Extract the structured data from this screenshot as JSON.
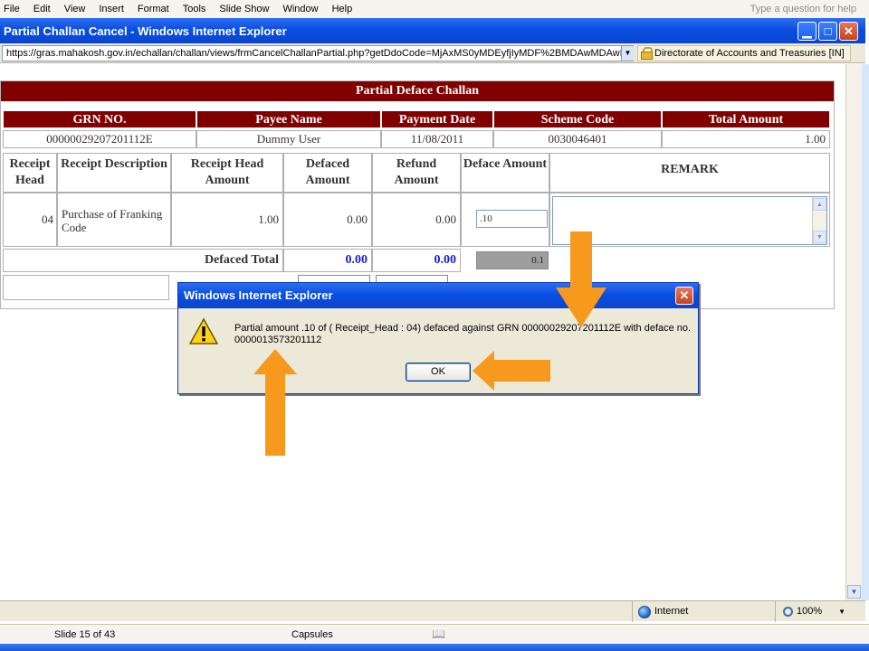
{
  "ppt_menu": [
    "File",
    "Edit",
    "View",
    "Insert",
    "Format",
    "Tools",
    "Slide Show",
    "Window",
    "Help"
  ],
  "ppt_help_placeholder": "Type a question for help",
  "ie_title": "Partial Challan Cancel - Windows Internet Explorer",
  "address_url": "https://gras.mahakosh.gov.in/echallan/challan/views/frmCancelChallanPartial.php?getDdoCode=MjAxMS0yMDEyfjIyMDF%2BMDAwMDAwMj",
  "cert_label": "Directorate of Accounts and Treasuries [IN]",
  "form": {
    "title": "Partial Deface Challan",
    "summary_headers": [
      "GRN NO.",
      "Payee Name",
      "Payment Date",
      "Scheme Code",
      "Total Amount"
    ],
    "summary_values": [
      "00000029207201112E",
      "Dummy User",
      "11/08/2011",
      "0030046401",
      "1.00"
    ],
    "detail_headers": {
      "receipt_head": "Receipt Head",
      "receipt_desc": "Receipt Description",
      "head_amount": "Receipt Head Amount",
      "defaced_amount": "Defaced Amount",
      "refund_amount": "Refund Amount",
      "deface_amount": "Deface Amount",
      "remark": "REMARK"
    },
    "row": {
      "receipt_head": "04",
      "receipt_desc": "Purchase of Franking Code",
      "head_amount": "1.00",
      "defaced_amount": "0.00",
      "refund_amount": "0.00",
      "deface_input": ".10"
    },
    "totals": {
      "label": "Defaced Total",
      "defaced": "0.00",
      "refund": "0.00",
      "deface": "0.1"
    }
  },
  "dialog": {
    "title": "Windows Internet Explorer",
    "message": "Partial amount .10 of ( Receipt_Head : 04)  defaced against GRN 00000029207201112E with deface no. 0000013573201112",
    "ok_label": "OK"
  },
  "ie_status": {
    "zone": "Internet",
    "zoom": "100%"
  },
  "ppt_status": {
    "slide": "Slide 15 of 43",
    "theme": "Capsules"
  },
  "colors": {
    "header_maroon": "#800000",
    "xp_blue": "#0a4fe0",
    "arrow_orange": "#f7991c"
  }
}
